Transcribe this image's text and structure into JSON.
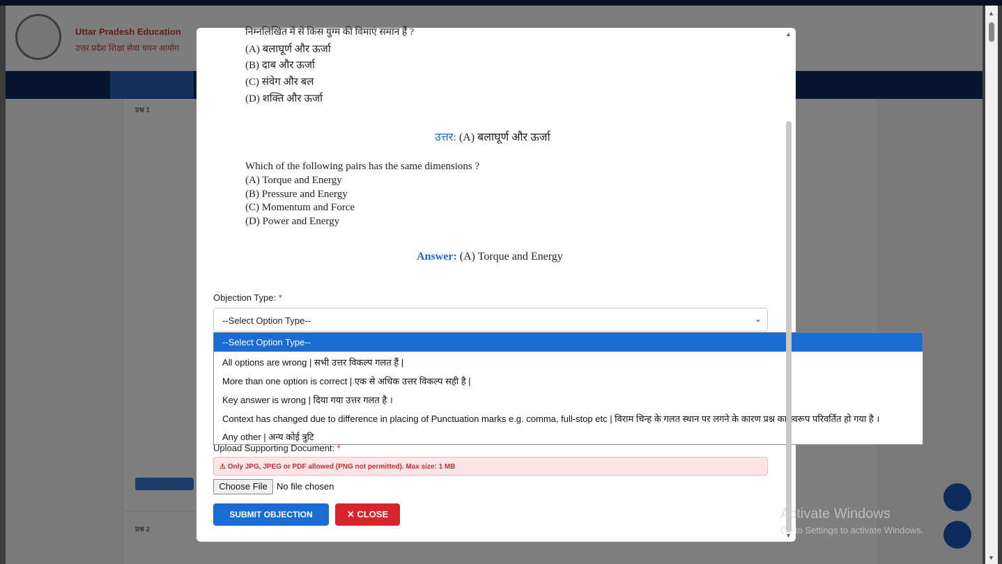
{
  "background": {
    "org_name_en": "Uttar Pradesh Education",
    "org_name_hi": "उत्तर प्रदेश शिक्षा सेवा चयन आयोग",
    "question_labels": [
      "प्रश्न 1",
      "प्रश्न 2"
    ]
  },
  "modal": {
    "top_question_hi": "निम्नलिखित में से किस युग्म की विमाएं समान हैं ?",
    "options_hi": [
      "(A) बलाघूर्ण और ऊर्जा",
      "(B) दाब और ऊर्जा",
      "(C) संवेग और बल",
      "(D) शक्ति और ऊर्जा"
    ],
    "answer_hi_label": "उत्तर:",
    "answer_hi_value": "(A) बलाघूर्ण और ऊर्जा",
    "question_en": "Which of the following pairs has the same dimensions ?",
    "options_en": [
      "(A) Torque and Energy",
      "(B) Pressure and Energy",
      "(C) Momentum and Force",
      "(D) Power and Energy"
    ],
    "answer_en_label": "Answer:",
    "answer_en_value": "(A) Torque and Energy",
    "objection_type_label": "Objection Type:",
    "required_mark": "*",
    "select_value": "--Select Option Type--",
    "dropdown_options": [
      "--Select Option Type--",
      "All options are wrong | सभी उत्तर विकल्प गलत हैं |",
      "More than one option is correct | एक से अधिक उत्तर विकल्प सही है |",
      "Key answer is wrong | दिया गया उत्तर गलत है ।",
      "Context has changed due to difference in placing of Punctuation marks e.g. comma, full-stop etc | विराम चिन्ह के गलत स्थान पर लगने के कारण प्रश्न का स्वरूप परिवर्तित हो गया है ।",
      "Any other | अन्य कोई त्रुटि"
    ],
    "upload_label": "Upload Supporting Document:",
    "upload_alert": "⚠ Only JPG, JPEG or PDF allowed (PNG not permitted). Max size: 1 MB",
    "choose_file_label": "Choose File",
    "no_file_text": "No file chosen",
    "submit_label": "SUBMIT OBJECTION",
    "close_label": "✕ CLOSE"
  },
  "watermark": {
    "line1": "Activate Windows",
    "line2": "Go to Settings to activate Windows."
  },
  "colors": {
    "accent": "#1b6cd2",
    "danger": "#d8242c",
    "alert_bg": "#fde4e6"
  }
}
